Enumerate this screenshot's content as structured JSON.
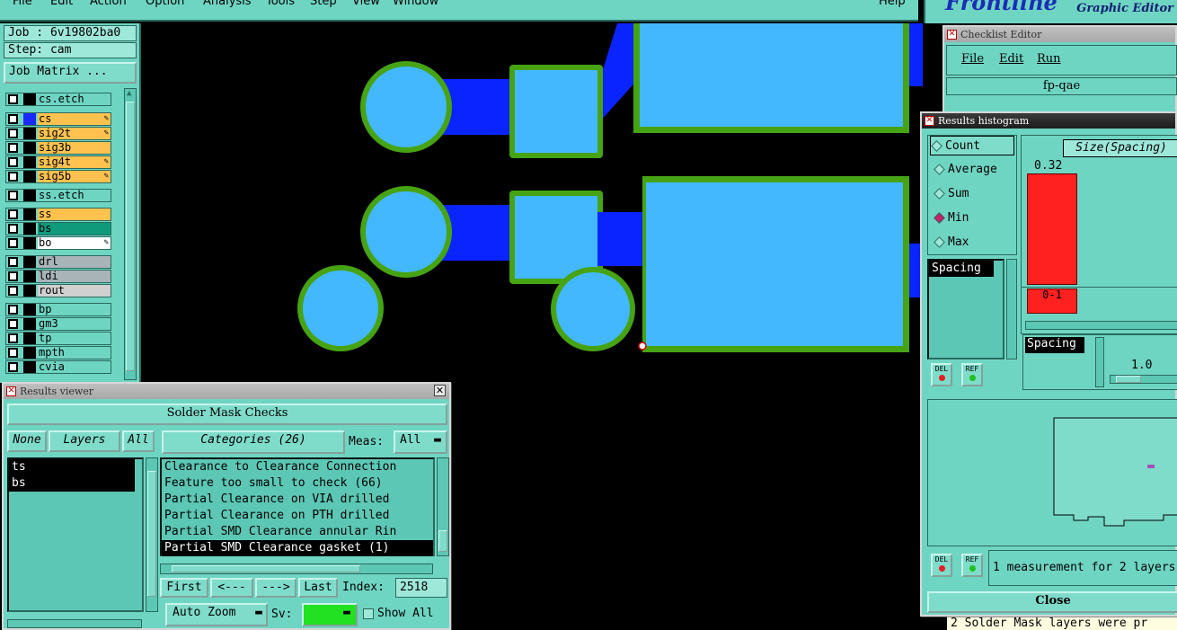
{
  "menubar": {
    "items": [
      "File",
      "Edit",
      "Action",
      "Option",
      "Analysis",
      "Tools",
      "Step",
      "View",
      "Window"
    ],
    "help": "Help"
  },
  "logo": {
    "brand": "Frontline",
    "sub": "Graphic Editor"
  },
  "left_panel": {
    "job": "Job : 6v19802ba0",
    "step": "Step: cam",
    "job_matrix_button": "Job Matrix ...",
    "layers": [
      {
        "name": "cs.etch",
        "color": "#6fd5c3",
        "swatch": "#000000"
      },
      {
        "name": "cs",
        "color": "#ffc24f",
        "swatch": "#1a2aff",
        "flag": "✎"
      },
      {
        "name": "sig2t",
        "color": "#ffc24f",
        "swatch": "#000000",
        "flag": "✎"
      },
      {
        "name": "sig3b",
        "color": "#ffc24f",
        "swatch": "#000000"
      },
      {
        "name": "sig4t",
        "color": "#ffc24f",
        "swatch": "#000000",
        "flag": "✎"
      },
      {
        "name": "sig5b",
        "color": "#ffc24f",
        "swatch": "#000000",
        "flag": "✎"
      },
      {
        "name": "ss.etch",
        "color": "#6fd5c3",
        "swatch": "#000000"
      },
      {
        "name": "ss",
        "color": "#ffc24f",
        "swatch": "#000000"
      },
      {
        "name": "bs",
        "color": "#0f9a7c",
        "swatch": "#000000"
      },
      {
        "name": "bo",
        "color": "#ffffff",
        "swatch": "#000000",
        "flag": "✎"
      },
      {
        "name": "drl",
        "color": "#a8b4b8",
        "swatch": "#000000"
      },
      {
        "name": "ldi",
        "color": "#a8b4b8",
        "swatch": "#000000"
      },
      {
        "name": "rout",
        "color": "#d0d0d0",
        "swatch": "#000000"
      },
      {
        "name": "bp",
        "color": "#6fd5c3",
        "swatch": "#000000"
      },
      {
        "name": "gm3",
        "color": "#6fd5c3",
        "swatch": "#000000"
      },
      {
        "name": "tp",
        "color": "#6fd5c3",
        "swatch": "#000000"
      },
      {
        "name": "mpth",
        "color": "#6fd5c3",
        "swatch": "#000000"
      },
      {
        "name": "cvia",
        "color": "#6fd5c3",
        "swatch": "#000000"
      }
    ]
  },
  "results_viewer": {
    "title": "Results viewer",
    "header": "Solder Mask Checks",
    "none_btn": "None",
    "layers_btn": "Layers",
    "all_btn": "All",
    "categories_btn": "Categories (26)",
    "meas_label": "Meas:",
    "meas_value": "All",
    "layer_list": [
      "ts",
      "bs"
    ],
    "category_list": [
      "Clearance to Clearance Connection",
      "Feature too small to check (66)",
      "Partial Clearance on VIA drilled",
      "Partial Clearance on PTH drilled",
      "Partial SMD Clearance annular Rin",
      "Partial SMD Clearance gasket (1)"
    ],
    "first_btn": "First",
    "prev_btn": "<---",
    "next_btn": "--->",
    "last_btn": "Last",
    "index_label": "Index:",
    "index_value": "2518",
    "auto_zoom": "Auto Zoom",
    "sv_label": "Sv:",
    "show_all": "Show All"
  },
  "checklist_editor": {
    "title": "Checklist Editor",
    "menu": [
      "File",
      "Edit",
      "Run"
    ],
    "name": "fp-qae"
  },
  "results_histogram": {
    "title": "Results histogram",
    "radios": [
      {
        "label": "Count",
        "selected": false
      },
      {
        "label": "Average",
        "selected": false
      },
      {
        "label": "Sum",
        "selected": false
      },
      {
        "label": "Min",
        "selected": true
      },
      {
        "label": "Max",
        "selected": false
      }
    ],
    "list_item": "Spacing",
    "x_field": "Spacing",
    "size_label": "Size(Spacing)",
    "bar_value": "0.32",
    "bin_label": "0-1",
    "scale_value": "1.0",
    "del_label": "DEL",
    "ref_label": "REF",
    "status": "1 measurement for 2 layers",
    "close_btn": "Close",
    "bottom_text": "2 Solder Mask layers were pr"
  },
  "colors": {
    "panel": "#6fd5c3",
    "pad": "#44b8ff",
    "trace": "#0a24ff",
    "mask": "#46a314",
    "hist_bar": "#ff2020"
  }
}
